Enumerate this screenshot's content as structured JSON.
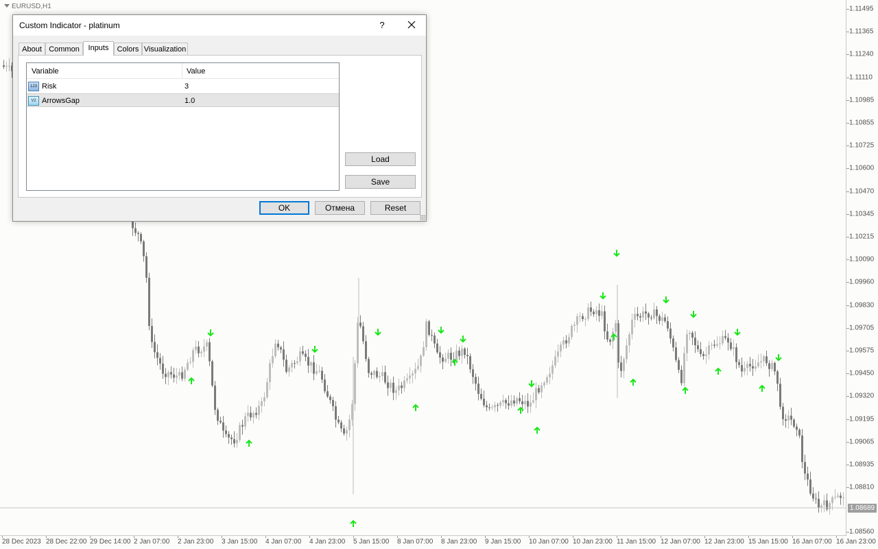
{
  "chart": {
    "symbol": "EURUSD,H1",
    "current_price": "1.08689",
    "price_labels": [
      "1.11495",
      "1.11365",
      "1.11240",
      "1.11110",
      "1.10985",
      "1.10855",
      "1.10725",
      "1.10600",
      "1.10470",
      "1.10345",
      "1.10215",
      "1.10090",
      "1.09960",
      "1.09830",
      "1.09705",
      "1.09575",
      "1.09450",
      "1.09320",
      "1.09195",
      "1.09065",
      "1.08935",
      "1.08810",
      "1.08560"
    ],
    "time_labels": [
      "28 Dec 2023",
      "28 Dec 22:00",
      "29 Dec 14:00",
      "2 Jan 07:00",
      "2 Jan 23:00",
      "3 Jan 15:00",
      "4 Jan 07:00",
      "4 Jan 23:00",
      "5 Jan 15:00",
      "8 Jan 07:00",
      "8 Jan 23:00",
      "9 Jan 15:00",
      "10 Jan 07:00",
      "10 Jan 23:00",
      "11 Jan 15:00",
      "12 Jan 07:00",
      "12 Jan 23:00",
      "15 Jan 15:00",
      "16 Jan 07:00",
      "16 Jan 23:00"
    ],
    "colors": {
      "bull": "#bdbdbd",
      "bear": "#7a7a7a",
      "signal_arrow": "#19e619",
      "background": "#fcfcfa"
    }
  },
  "dialog": {
    "title": "Custom Indicator - platinum",
    "help_label": "?",
    "tabs": [
      {
        "label": "About",
        "active": false
      },
      {
        "label": "Common",
        "active": false
      },
      {
        "label": "Inputs",
        "active": true
      },
      {
        "label": "Colors",
        "active": false
      },
      {
        "label": "Visualization",
        "active": false
      }
    ],
    "table": {
      "col_variable": "Variable",
      "col_value": "Value",
      "rows": [
        {
          "icon": "int-type-icon",
          "icon_text": "123",
          "name": "Risk",
          "value": "3",
          "selected": false
        },
        {
          "icon": "double-type-icon",
          "icon_text": "V2",
          "name": "ArrowsGap",
          "value": "1.0",
          "selected": true
        }
      ]
    },
    "buttons": {
      "load": "Load",
      "save": "Save",
      "ok": "OK",
      "cancel": "Отмена",
      "reset": "Reset"
    }
  }
}
